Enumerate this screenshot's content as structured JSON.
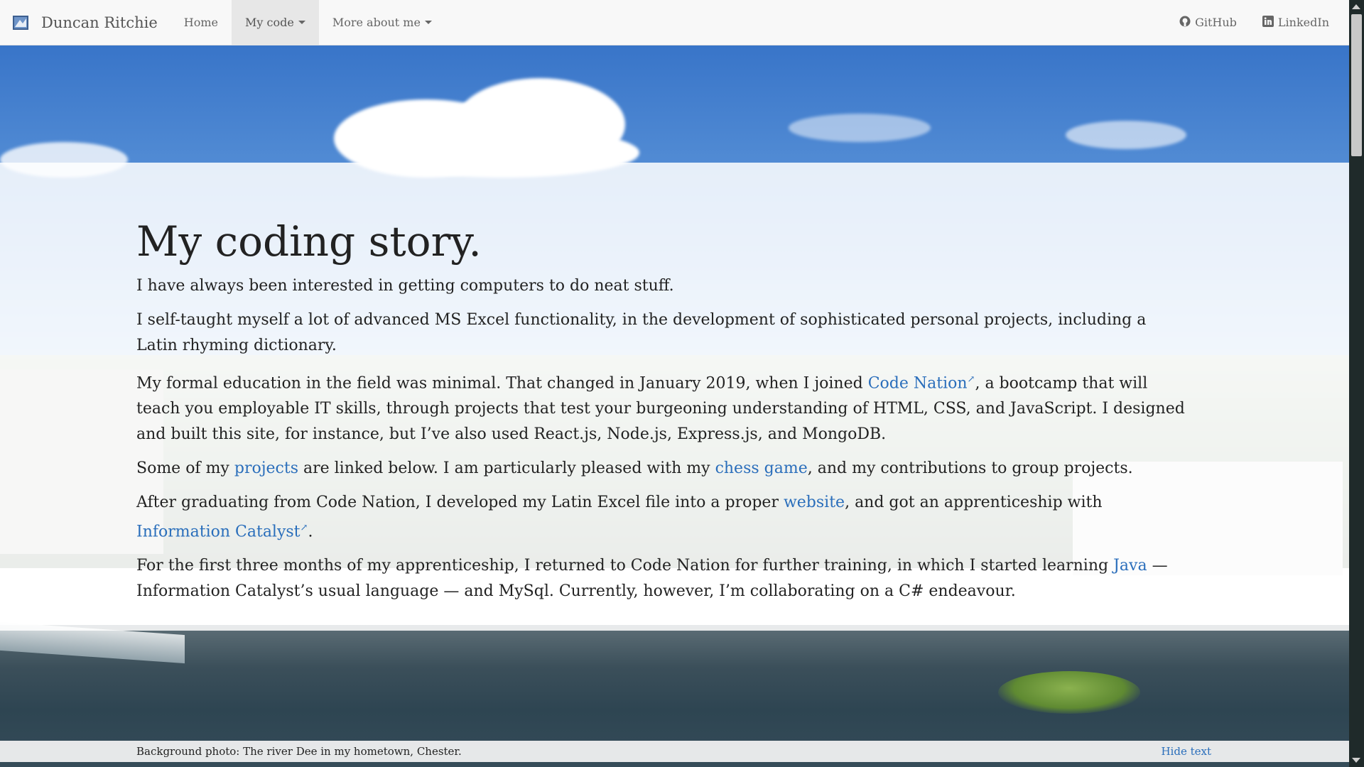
{
  "navbar": {
    "brand": "Duncan Ritchie",
    "items": [
      {
        "label": "Home"
      },
      {
        "label": "My code"
      },
      {
        "label": "More about me"
      }
    ],
    "right": [
      {
        "label": "GitHub",
        "icon": "github-icon"
      },
      {
        "label": "LinkedIn",
        "icon": "linkedin-icon"
      }
    ]
  },
  "content": {
    "title": "My coding story.",
    "p1": "I have always been interested in getting computers to do neat stuff.",
    "p2": "I self-taught myself a lot of advanced MS Excel functionality, in the development of sophisticated personal projects, including a Latin rhyming dictionary.",
    "p3": {
      "a": "My formal education in the field was minimal. That changed in January 2019, when I joined ",
      "link": "Code Nation",
      "b": ", a bootcamp that will teach you employable IT skills, through projects that test your burgeoning understanding of HTML, CSS, and JavaScript. I designed and built this site, for instance, but I’ve also used React.js, Node.js, Express.js, and MongoDB."
    },
    "p4": {
      "a": "Some of my ",
      "link1": "projects",
      "b": " are linked below. I am particularly pleased with my ",
      "link2": "chess game",
      "c": ", and my contributions to group projects."
    },
    "p5": {
      "a": "After graduating from Code Nation, I developed my Latin Excel file into a proper ",
      "link1": "website",
      "b": ", and got an apprenticeship with ",
      "link2": "Information Catalyst",
      "c": "."
    },
    "p6": {
      "a": "For the first three months of my apprenticeship, I returned to Code Nation for further training, in which I started learning ",
      "link": "Java",
      "b": " — Information Catalyst’s usual language — and MySql. Currently, however, I’m collaborating on a C# endeavour."
    },
    "external_marker": "↗"
  },
  "footer": {
    "caption": "Background photo: The river Dee in my hometown, Chester.",
    "hide": "Hide text"
  },
  "colors": {
    "link": "#2a6ebb",
    "navbar_bg": "#f8f8f8",
    "active_nav_bg": "#e7e7e7"
  }
}
